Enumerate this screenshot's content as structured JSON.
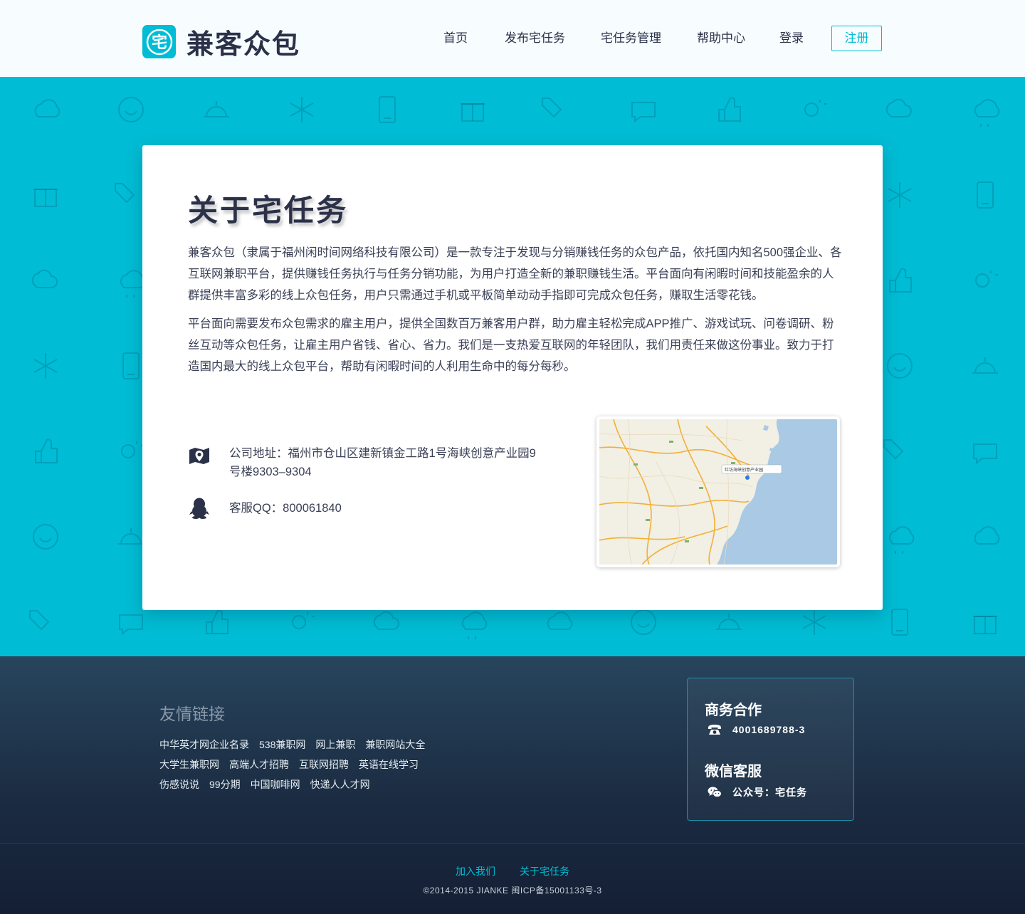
{
  "header": {
    "logo_glyph": "宅",
    "logo_text": "兼客众包",
    "nav": [
      {
        "label": "首页"
      },
      {
        "label": "发布宅任务"
      },
      {
        "label": "宅任务管理"
      },
      {
        "label": "帮助中心"
      },
      {
        "label": "登录"
      }
    ],
    "register_label": "注册"
  },
  "about": {
    "title": "关于宅任务",
    "paragraph1": "兼客众包（隶属于福州闲时间网络科技有限公司）是一款专注于发现与分销赚钱任务的众包产品，依托国内知名500强企业、各互联网兼职平台，提供赚钱任务执行与任务分销功能，为用户打造全新的兼职赚钱生活。平台面向有闲暇时间和技能盈余的人群提供丰富多彩的线上众包任务，用户只需通过手机或平板简单动动手指即可完成众包任务，赚取生活零花钱。",
    "paragraph2": "平台面向需要发布众包需求的雇主用户，提供全国数百万兼客用户群，助力雇主轻松完成APP推广、游戏试玩、问卷调研、粉丝互动等众包任务，让雇主用户省钱、省心、省力。我们是一支热爱互联网的年轻团队，我们用责任来做这份事业。致力于打造国内最大的线上众包平台，帮助有闲暇时间的人利用生命中的每分每秒。",
    "address": "公司地址：福州市仓山区建新镇金工路1号海峡创意产业园9号楼9303–9304",
    "qq": "客服QQ：800061840",
    "map_marker_label": "红坊海峡创意产业园"
  },
  "footer": {
    "links_title": "友情链接",
    "link_rows": [
      [
        "中华英才网企业名录",
        "538兼职网",
        "网上兼职",
        "兼职网站大全"
      ],
      [
        "大学生兼职网",
        "高端人才招聘",
        "互联网招聘",
        "英语在线学习"
      ],
      [
        "伤感说说",
        "99分期",
        "中国咖啡网",
        "快递人人才网"
      ]
    ],
    "biz_title": "商务合作",
    "biz_phone": "4001689788-3",
    "wechat_title": "微信客服",
    "wechat_account": "公众号：宅任务",
    "bottom_links": [
      "加入我们",
      "关于宅任务"
    ],
    "copyright": "©2014-2015 JIANKE 闽ICP备15001133号-3"
  },
  "colors": {
    "accent": "#00bcd4",
    "dark": "#2b3148",
    "footer": "#1a2a40"
  },
  "icons": [
    "map-icon",
    "qq-penguin-icon",
    "phone-icon",
    "wechat-icon"
  ]
}
